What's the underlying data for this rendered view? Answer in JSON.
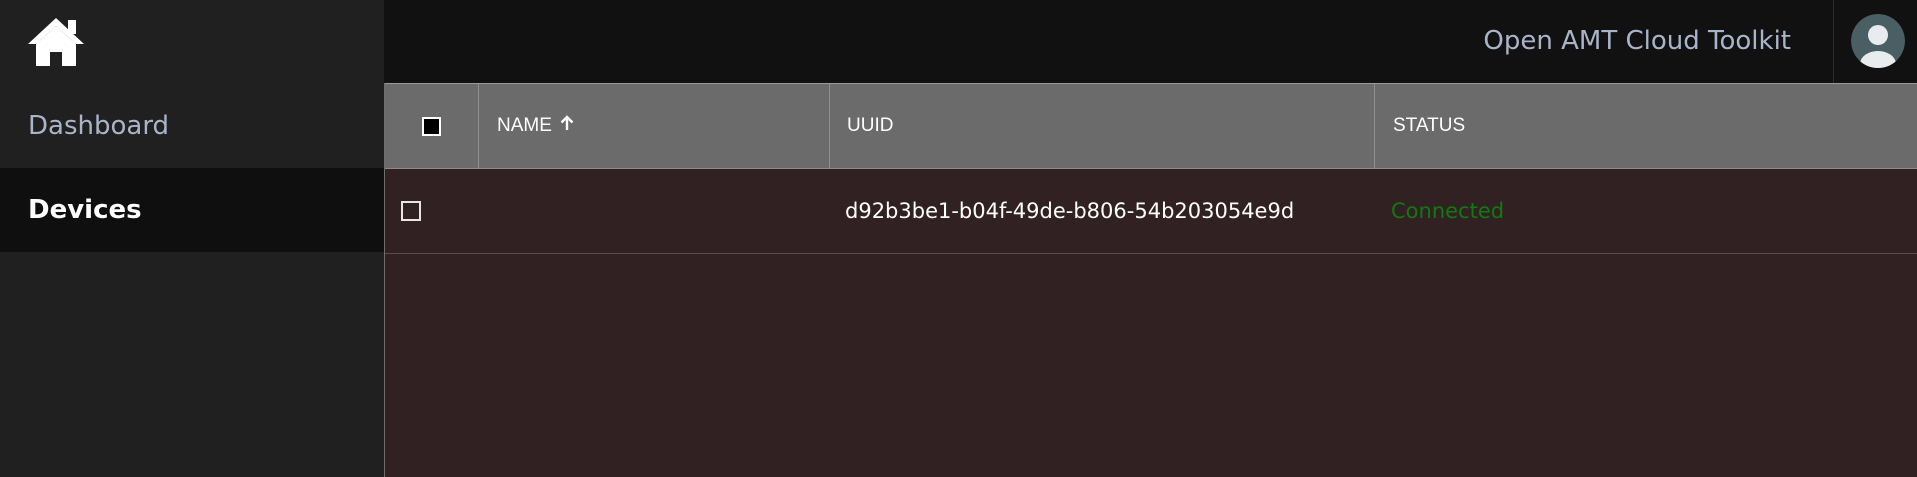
{
  "app": {
    "title": "Open AMT Cloud Toolkit"
  },
  "sidebar": {
    "items": [
      {
        "label": "Dashboard",
        "active": false
      },
      {
        "label": "Devices",
        "active": true
      }
    ],
    "home_icon": "home-icon"
  },
  "header": {
    "avatar_icon": "user-avatar-icon"
  },
  "table": {
    "columns": [
      {
        "label": "NAME",
        "sort": "ascending",
        "sort_icon": "arrow-up-icon"
      },
      {
        "label": "UUID"
      },
      {
        "label": "STATUS"
      }
    ],
    "rows": [
      {
        "name": "",
        "uuid": "d92b3be1-b04f-49de-b806-54b203054e9d",
        "status": "Connected",
        "selected": false
      }
    ],
    "select_all": false
  },
  "colors": {
    "sidebar_bg": "#202020",
    "header_bg": "#111111",
    "table_header_bg": "#6b6b6b",
    "table_body_bg": "#322122",
    "status_connected": "#0f7a0f",
    "nav_text": "#a9b4c8"
  }
}
